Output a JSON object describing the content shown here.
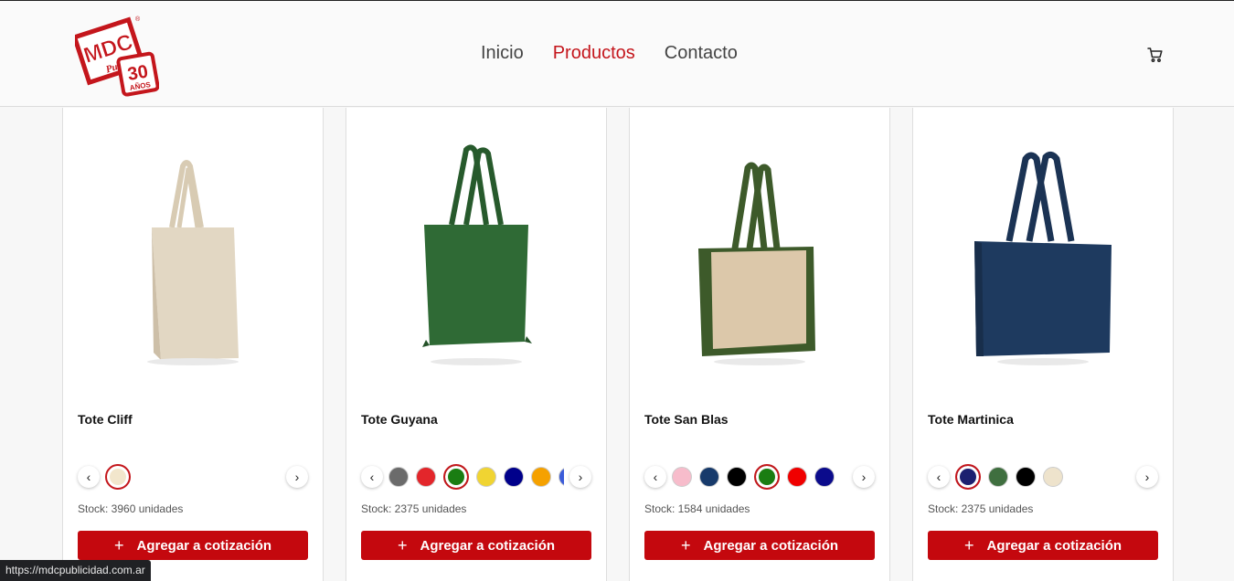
{
  "header": {
    "logo": {
      "top_text": "MDC",
      "side_text": "Publi",
      "badge_number": "30",
      "badge_text": "AÑOS",
      "registered": "®"
    },
    "nav": [
      {
        "label": "Inicio",
        "active": false
      },
      {
        "label": "Productos",
        "active": true
      },
      {
        "label": "Contacto",
        "active": false
      }
    ],
    "cart_icon": "cart-icon"
  },
  "colors": {
    "accent": "#c4161c",
    "button": "#c4080e"
  },
  "products": [
    {
      "name": "Tote Cliff",
      "stock": "Stock: 3960 unidades",
      "button_label": "Agregar a cotización",
      "swatches": [
        "#f2e6cc"
      ],
      "selected": 0,
      "bag": {
        "body": "#e2d7c3",
        "handle": "#d8cbb3",
        "side": "#cdbfa8"
      }
    },
    {
      "name": "Tote Guyana",
      "stock": "Stock: 2375 unidades",
      "button_label": "Agregar a cotización",
      "swatches": [
        "#6b6b6b",
        "#e3262b",
        "#1a7d12",
        "#f0d432",
        "#00008b",
        "#f5a100",
        "#3a5bd9"
      ],
      "selected": 2,
      "bag": {
        "body": "#2f6a35",
        "handle": "#275a2c",
        "side": "#245228"
      }
    },
    {
      "name": "Tote San Blas",
      "stock": "Stock: 1584 unidades",
      "button_label": "Agregar a cotización",
      "swatches": [
        "#f7bccb",
        "#173a6b",
        "#000000",
        "#1a7d12",
        "#f00000",
        "#0b0b8c"
      ],
      "selected": 3,
      "bag": {
        "body": "#dcc8aa",
        "handle": "#3d5a2a",
        "side": "#3d5a2a"
      }
    },
    {
      "name": "Tote Martinica",
      "stock": "Stock: 2375 unidades",
      "button_label": "Agregar a cotización",
      "swatches": [
        "#1c2070",
        "#3f6f3f",
        "#000000",
        "#eee3cc"
      ],
      "selected": 0,
      "bag": {
        "body": "#1e3a5f",
        "handle": "#1b3354",
        "side": "#182e4b"
      }
    }
  ],
  "status_url": "https://mdcpublicidad.com.ar"
}
